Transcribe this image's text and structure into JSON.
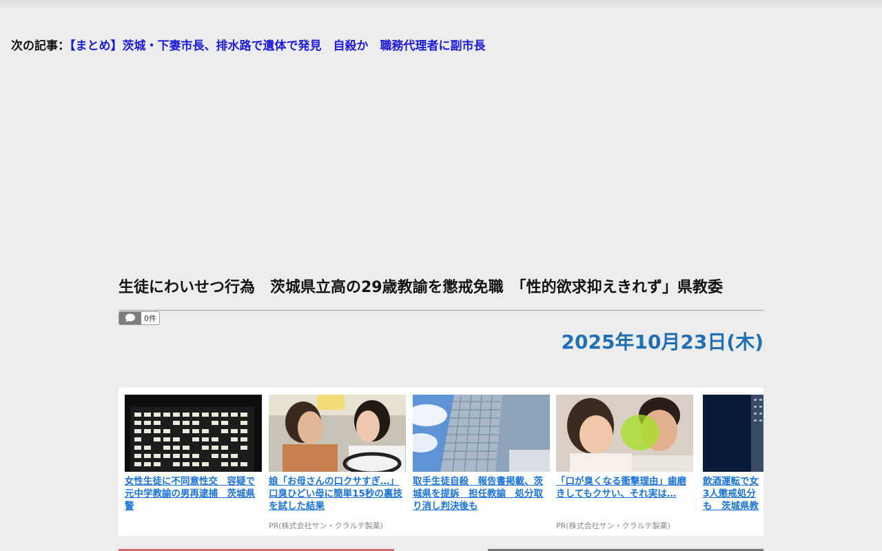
{
  "next_article": {
    "label": "次の記事：",
    "link": "【まとめ】茨城・下妻市長、排水路で遺体で発見　自殺か　職務代理者に副市長"
  },
  "article": {
    "title": "生徒にわいせつ行為　茨城県立高の29歳教諭を懲戒免職　「性的欲求抑えきれず」県教委",
    "comment_count": "0件",
    "date": "2025年10月23日(木)"
  },
  "cards": [
    {
      "title": "女性生徒に不同意性交　容疑で元中学教諭の男再逮捕　茨城県警",
      "pr": "",
      "thumb_icon": "night-office-building-photo"
    },
    {
      "title": "娘「お母さんの口クサすぎ…」口臭ひどい母に簡単15秒の裏技を試した結果",
      "pr": "PR(株式会社サン・クラルテ製薬)",
      "thumb_icon": "women-in-car-photo"
    },
    {
      "title": "取手生徒自殺　報告書掲載、茨城県を提訴　担任教諭　処分取り消し判決後も",
      "pr": "",
      "thumb_icon": "office-tower-photo"
    },
    {
      "title": "「口が臭くなる衝撃理由」歯磨きしてもクサい、それ実は…",
      "pr": "PR(株式会社サン・クラルテ製薬)",
      "thumb_icon": "bad-breath-couple-photo"
    },
    {
      "title": "飲酒運転で女3人懲戒処分も　茨城県教",
      "pr": "",
      "thumb_icon": "dark-building-photo"
    }
  ],
  "colors": {
    "link": "#1a1ad8",
    "date": "#1f6fb2",
    "card_link": "#1a73d6"
  }
}
